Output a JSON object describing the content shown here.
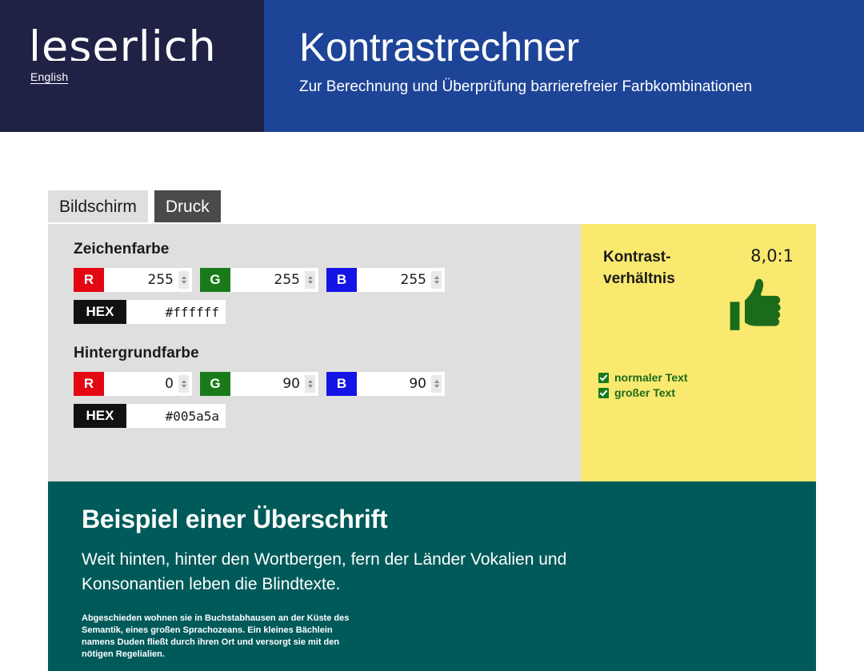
{
  "brand": {
    "logo_text": "leserlich",
    "language_link": "English"
  },
  "header": {
    "title": "Kontrastrechner",
    "subtitle": "Zur Berechnung und Überprüfung barrierefreier Farbkombinationen"
  },
  "tabs": [
    {
      "label": "Bildschirm",
      "active": true
    },
    {
      "label": "Druck",
      "active": false
    }
  ],
  "foreground": {
    "group_title": "Zeichenfarbe",
    "r_label": "R",
    "g_label": "G",
    "b_label": "B",
    "hex_label": "HEX",
    "r_value": "255",
    "g_value": "255",
    "b_value": "255",
    "hex_value": "#ffffff"
  },
  "background": {
    "group_title": "Hintergrundfarbe",
    "r_label": "R",
    "g_label": "G",
    "b_label": "B",
    "hex_label": "HEX",
    "r_value": "0",
    "g_value": "90",
    "b_value": "90",
    "hex_value": "#005a5a"
  },
  "result": {
    "ratio_label": "Kontrast-\nverhältnis",
    "ratio_label_line1": "Kontrast-",
    "ratio_label_line2": "verhältnis",
    "ratio_value": "8,0:1",
    "verdict_icon": "thumbs-up-icon",
    "checks": [
      {
        "label": "normaler Text",
        "checked": true
      },
      {
        "label": "großer Text",
        "checked": true
      }
    ]
  },
  "preview": {
    "heading": "Beispiel einer Überschrift",
    "body": "Weit hinten, hinter den Wortbergen, fern der Länder Vokalien und Konsonantien leben die Blindtexte.",
    "small": "Abgeschieden wohnen sie in Buchstabhausen an der Küste des Semantik, eines großen Sprachozeans. Ein kleines Bächlein namens Duden fließt durch ihren Ort und versorgt sie mit den nötigen Regelialien."
  },
  "colors": {
    "brand_navy": "#1f2245",
    "header_blue": "#1d4496",
    "panel_gray": "#dfdfdf",
    "result_yellow": "#fae96f",
    "preview_teal": "#005a5a",
    "channel_red": "#e30613",
    "channel_green": "#1a7a1a",
    "channel_blue": "#1414e6",
    "hex_black": "#111111",
    "verdict_green": "#1a6b1a",
    "tab_active_bg": "#dfdfdf",
    "tab_inactive_bg": "#4a4a4a"
  }
}
